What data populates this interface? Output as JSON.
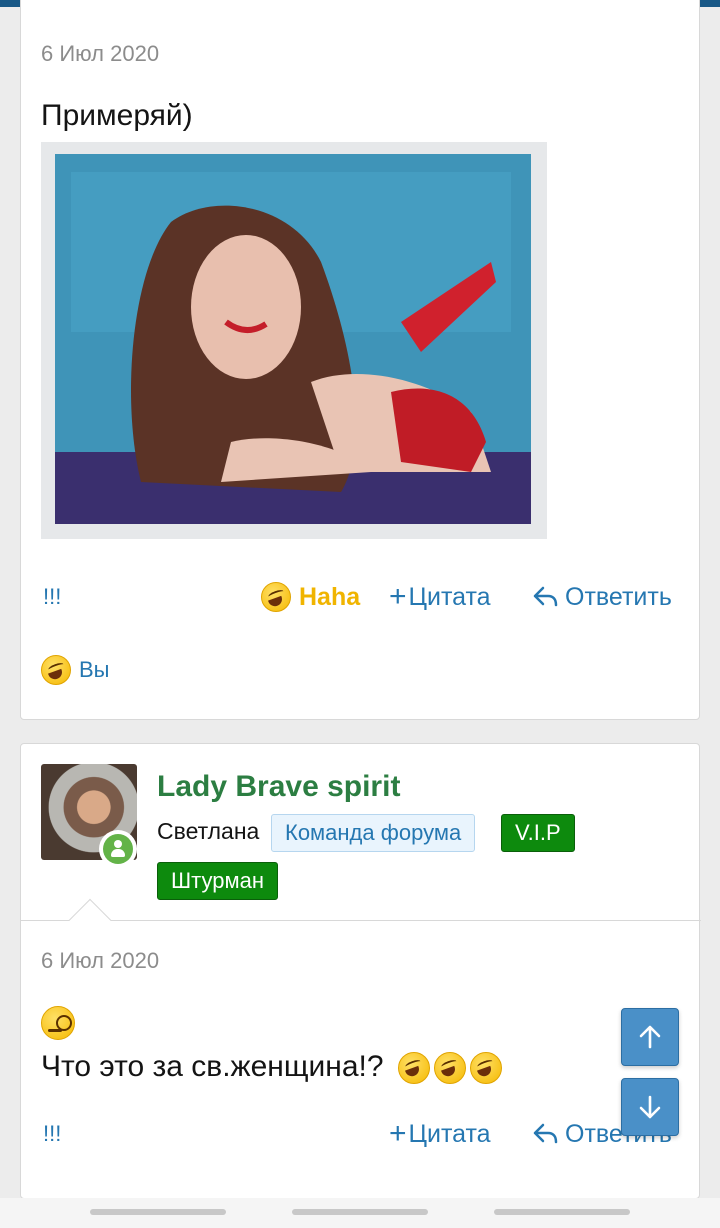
{
  "post1": {
    "date": "6 Июл 2020",
    "message": "Примеряй)",
    "actions": {
      "bang": "!!!",
      "haha": "Haha",
      "quote": "Цитата",
      "reply": "Ответить"
    },
    "reactor": "Вы"
  },
  "post2": {
    "username": "Lady Brave spirit",
    "user_title": "Светлана",
    "badges": {
      "team": "Команда форума",
      "vip": "V.I.P",
      "navigator": "Штурман"
    },
    "date": "6 Июл 2020",
    "message": "Что это за св.женщина!?",
    "actions": {
      "bang": "!!!",
      "quote": "Цитата",
      "reply": "Ответить"
    }
  },
  "colors": {
    "header": "#185886",
    "link": "#2577b1",
    "username": "#2c7e42",
    "haha": "#f0b400",
    "badge_green": "#0d8a0d",
    "scroll_button": "#4a90c8"
  },
  "icons": {
    "haha_reaction": "laughing-emoji-icon",
    "quote": "plus-icon",
    "reply": "reply-arrow-icon",
    "online": "user-online-icon",
    "scroll_up": "arrow-up-icon",
    "scroll_down": "arrow-down-icon"
  }
}
